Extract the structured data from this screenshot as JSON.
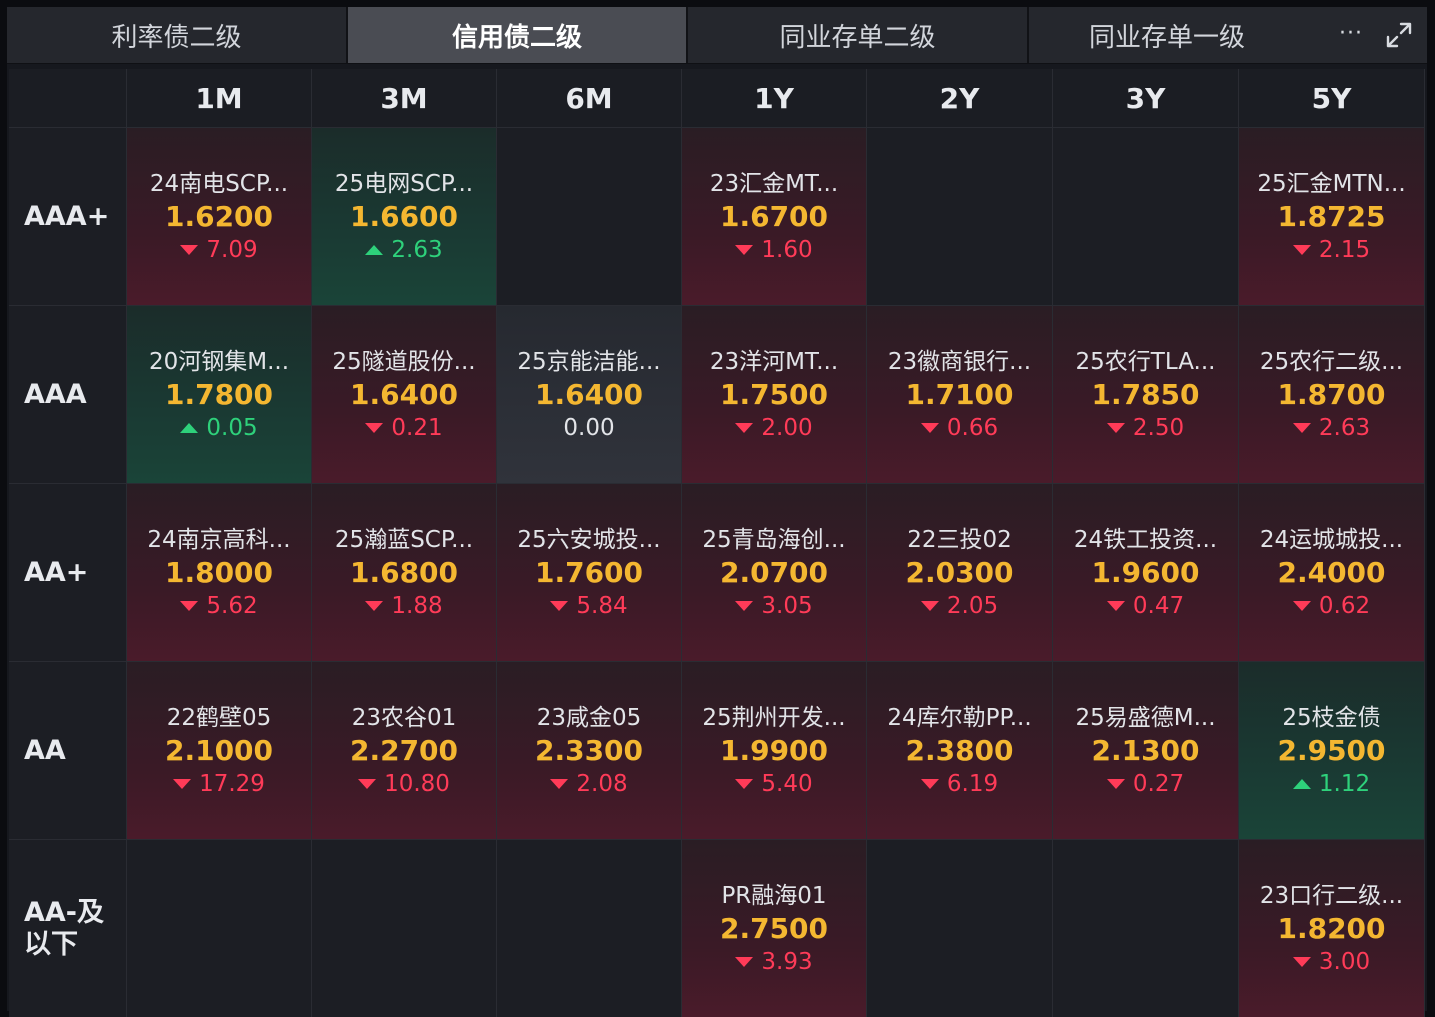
{
  "tabs": [
    {
      "label": "利率债二级",
      "active": false
    },
    {
      "label": "信用债二级",
      "active": true
    },
    {
      "label": "同业存单二级",
      "active": false
    },
    {
      "label": "同业存单一级",
      "active": false
    }
  ],
  "more_label": "···",
  "columns": [
    "1M",
    "3M",
    "6M",
    "1Y",
    "2Y",
    "3Y",
    "5Y"
  ],
  "rows": [
    {
      "label": "AAA+",
      "cells": [
        {
          "name": "24南电SCP...",
          "yield": "1.6200",
          "change": "7.09",
          "dir": "down"
        },
        {
          "name": "25电网SCP...",
          "yield": "1.6600",
          "change": "2.63",
          "dir": "up"
        },
        null,
        {
          "name": "23汇金MT...",
          "yield": "1.6700",
          "change": "1.60",
          "dir": "down"
        },
        null,
        null,
        {
          "name": "25汇金MTN...",
          "yield": "1.8725",
          "change": "2.15",
          "dir": "down"
        }
      ]
    },
    {
      "label": "AAA",
      "cells": [
        {
          "name": "20河钢集M...",
          "yield": "1.7800",
          "change": "0.05",
          "dir": "up"
        },
        {
          "name": "25隧道股份...",
          "yield": "1.6400",
          "change": "0.21",
          "dir": "down"
        },
        {
          "name": "25京能洁能...",
          "yield": "1.6400",
          "change": "0.00",
          "dir": "flat"
        },
        {
          "name": "23洋河MT...",
          "yield": "1.7500",
          "change": "2.00",
          "dir": "down"
        },
        {
          "name": "23徽商银行...",
          "yield": "1.7100",
          "change": "0.66",
          "dir": "down"
        },
        {
          "name": "25农行TLA...",
          "yield": "1.7850",
          "change": "2.50",
          "dir": "down"
        },
        {
          "name": "25农行二级...",
          "yield": "1.8700",
          "change": "2.63",
          "dir": "down"
        }
      ]
    },
    {
      "label": "AA+",
      "cells": [
        {
          "name": "24南京高科...",
          "yield": "1.8000",
          "change": "5.62",
          "dir": "down"
        },
        {
          "name": "25瀚蓝SCP...",
          "yield": "1.6800",
          "change": "1.88",
          "dir": "down"
        },
        {
          "name": "25六安城投...",
          "yield": "1.7600",
          "change": "5.84",
          "dir": "down"
        },
        {
          "name": "25青岛海创...",
          "yield": "2.0700",
          "change": "3.05",
          "dir": "down"
        },
        {
          "name": "22三投02",
          "yield": "2.0300",
          "change": "2.05",
          "dir": "down"
        },
        {
          "name": "24铁工投资...",
          "yield": "1.9600",
          "change": "0.47",
          "dir": "down"
        },
        {
          "name": "24运城城投...",
          "yield": "2.4000",
          "change": "0.62",
          "dir": "down"
        }
      ]
    },
    {
      "label": "AA",
      "cells": [
        {
          "name": "22鹤壁05",
          "yield": "2.1000",
          "change": "17.29",
          "dir": "down"
        },
        {
          "name": "23农谷01",
          "yield": "2.2700",
          "change": "10.80",
          "dir": "down"
        },
        {
          "name": "23咸金05",
          "yield": "2.3300",
          "change": "2.08",
          "dir": "down"
        },
        {
          "name": "25荆州开发...",
          "yield": "1.9900",
          "change": "5.40",
          "dir": "down"
        },
        {
          "name": "24库尔勒PP...",
          "yield": "2.3800",
          "change": "6.19",
          "dir": "down"
        },
        {
          "name": "25易盛德M...",
          "yield": "2.1300",
          "change": "0.27",
          "dir": "down"
        },
        {
          "name": "25枝金债",
          "yield": "2.9500",
          "change": "1.12",
          "dir": "up"
        }
      ]
    },
    {
      "label": "AA-及以下",
      "label_lines": [
        "AA-及",
        "以下"
      ],
      "cells": [
        null,
        null,
        null,
        {
          "name": "PR融海01",
          "yield": "2.7500",
          "change": "3.93",
          "dir": "down"
        },
        null,
        null,
        {
          "name": "23口行二级...",
          "yield": "1.8200",
          "change": "3.00",
          "dir": "down"
        }
      ]
    }
  ],
  "colors": {
    "yield": "#f4b731",
    "down": "#ff3b58",
    "up": "#2ed17b",
    "background": "#16181e"
  },
  "icons": {
    "more": "more-dots-icon",
    "expand": "expand-icon"
  }
}
